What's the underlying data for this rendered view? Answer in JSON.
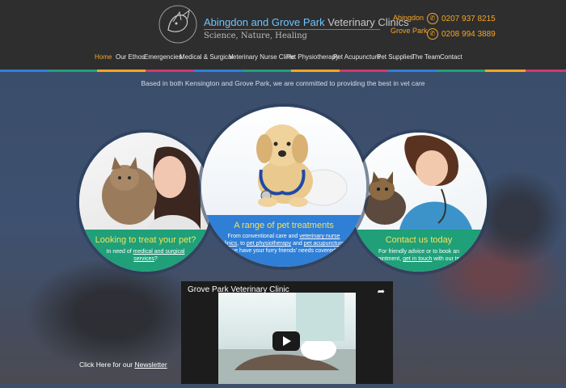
{
  "header": {
    "brand_name": "Abingdon and Grove Park",
    "brand_suffix": "Veterinary Clinics",
    "tagline": "Science, Nature, Healing",
    "locations": [
      {
        "name": "Abingdon",
        "phone": "0207 937 8215"
      },
      {
        "name": "Grove Park",
        "phone": "0208 994 3889"
      }
    ],
    "phone_icon": "phone-icon"
  },
  "nav": {
    "items": [
      "Home",
      "Our Ethos",
      "Emergencies",
      "Medical & Surgical",
      "Veterinary Nurse Clinic",
      "Pet Physiotherapy",
      "Pet Acupuncture",
      "Pet Supplies",
      "The Team",
      "Contact"
    ],
    "active": "Home"
  },
  "hero": {
    "intro": "Based in both Kensington and Grove Park, we are committed to providing the best in vet care",
    "left": {
      "heading": "Looking to treat your pet?",
      "text_pre": "In need of ",
      "link": "medical and surgical services",
      "text_post": "?"
    },
    "middle": {
      "heading": "A range of pet treatments",
      "text_1": "From conventional care and ",
      "link_1": "veterinary nurse clinics",
      "text_2": ", to ",
      "link_2": "pet physiotherapy",
      "text_3": " and ",
      "link_3": "pet acupuncture",
      "text_4": ", we have your furry friends' needs covered."
    },
    "right": {
      "heading": "Contact us today",
      "text_1": "For friendly advice or to book an appointment, ",
      "link_1": "get in touch",
      "text_2": " with our ",
      "link_2": "team",
      "text_3": "."
    }
  },
  "video": {
    "title": "Grove Park Veterinary Clinic",
    "share_icon": "share-icon",
    "play_icon": "play-icon"
  },
  "footer": {
    "newsletter_pre": "Click Here for our ",
    "newsletter_link": "Newsletter"
  },
  "colors": {
    "accent": "#f6a623",
    "brand_blue": "#6fc3ff",
    "band_green": "#1fa079",
    "band_blue": "#2f7fd6",
    "heading_yellow": "#f3e25a",
    "header_bg": "#2e2e2f"
  }
}
